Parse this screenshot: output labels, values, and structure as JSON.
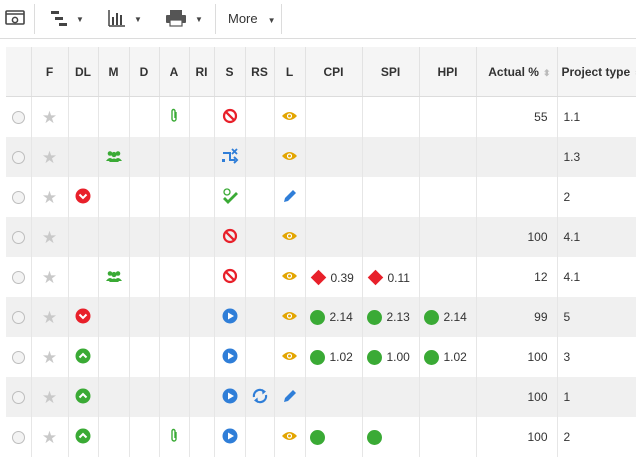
{
  "toolbar": {
    "more_label": "More",
    "buttons": [
      {
        "name": "preview-icon"
      },
      {
        "name": "hierarchy-icon"
      },
      {
        "name": "bar-chart-icon"
      },
      {
        "name": "printer-icon"
      }
    ]
  },
  "columns": [
    "",
    "F",
    "DL",
    "M",
    "D",
    "A",
    "RI",
    "S",
    "RS",
    "L",
    "CPI",
    "SPI",
    "HPI",
    "Actual %",
    "Project type"
  ],
  "rows": [
    {
      "dl": "",
      "m": "",
      "a": "paperclip",
      "s": "stop",
      "rs": "",
      "l": "eye",
      "cpi": null,
      "spi": null,
      "hpi": null,
      "actual": "55",
      "type": "1.1"
    },
    {
      "dl": "",
      "m": "group",
      "a": "",
      "s": "shuffle",
      "rs": "",
      "l": "eye",
      "cpi": null,
      "spi": null,
      "hpi": null,
      "actual": "",
      "type": "1.3"
    },
    {
      "dl": "down",
      "m": "",
      "a": "",
      "s": "check",
      "rs": "",
      "l": "pencil",
      "cpi": null,
      "spi": null,
      "hpi": null,
      "actual": "",
      "type": "2"
    },
    {
      "dl": "",
      "m": "",
      "a": "",
      "s": "stop",
      "rs": "",
      "l": "eye",
      "cpi": null,
      "spi": null,
      "hpi": null,
      "actual": "100",
      "type": "4.1"
    },
    {
      "dl": "",
      "m": "group",
      "a": "",
      "s": "stop",
      "rs": "",
      "l": "eye",
      "cpi": {
        "v": "0.39",
        "k": "diamond"
      },
      "spi": {
        "v": "0.11",
        "k": "diamond"
      },
      "hpi": null,
      "actual": "12",
      "type": "4.1"
    },
    {
      "dl": "down",
      "m": "",
      "a": "",
      "s": "play",
      "rs": "",
      "l": "eye",
      "cpi": {
        "v": "2.14",
        "k": "dot"
      },
      "spi": {
        "v": "2.13",
        "k": "dot"
      },
      "hpi": {
        "v": "2.14",
        "k": "dot"
      },
      "actual": "99",
      "type": "5"
    },
    {
      "dl": "up",
      "m": "",
      "a": "",
      "s": "play",
      "rs": "",
      "l": "eye",
      "cpi": {
        "v": "1.02",
        "k": "dot"
      },
      "spi": {
        "v": "1.00",
        "k": "dot"
      },
      "hpi": {
        "v": "1.02",
        "k": "dot"
      },
      "actual": "100",
      "type": "3"
    },
    {
      "dl": "up",
      "m": "",
      "a": "",
      "s": "play",
      "rs": "refresh",
      "l": "pencil",
      "cpi": null,
      "spi": null,
      "hpi": null,
      "actual": "100",
      "type": "1"
    },
    {
      "dl": "up",
      "m": "",
      "a": "paperclip",
      "s": "play",
      "rs": "",
      "l": "eye",
      "cpi": {
        "v": "",
        "k": "dot"
      },
      "spi": {
        "v": "",
        "k": "dot"
      },
      "hpi": null,
      "actual": "100",
      "type": "2"
    }
  ],
  "colors": {
    "red": "#e8202a",
    "green": "#3aaa35",
    "blue": "#2f7ed8",
    "amber": "#e3a500",
    "header_bg": "#f5f5f5",
    "alt_row": "#f0f0f0"
  }
}
